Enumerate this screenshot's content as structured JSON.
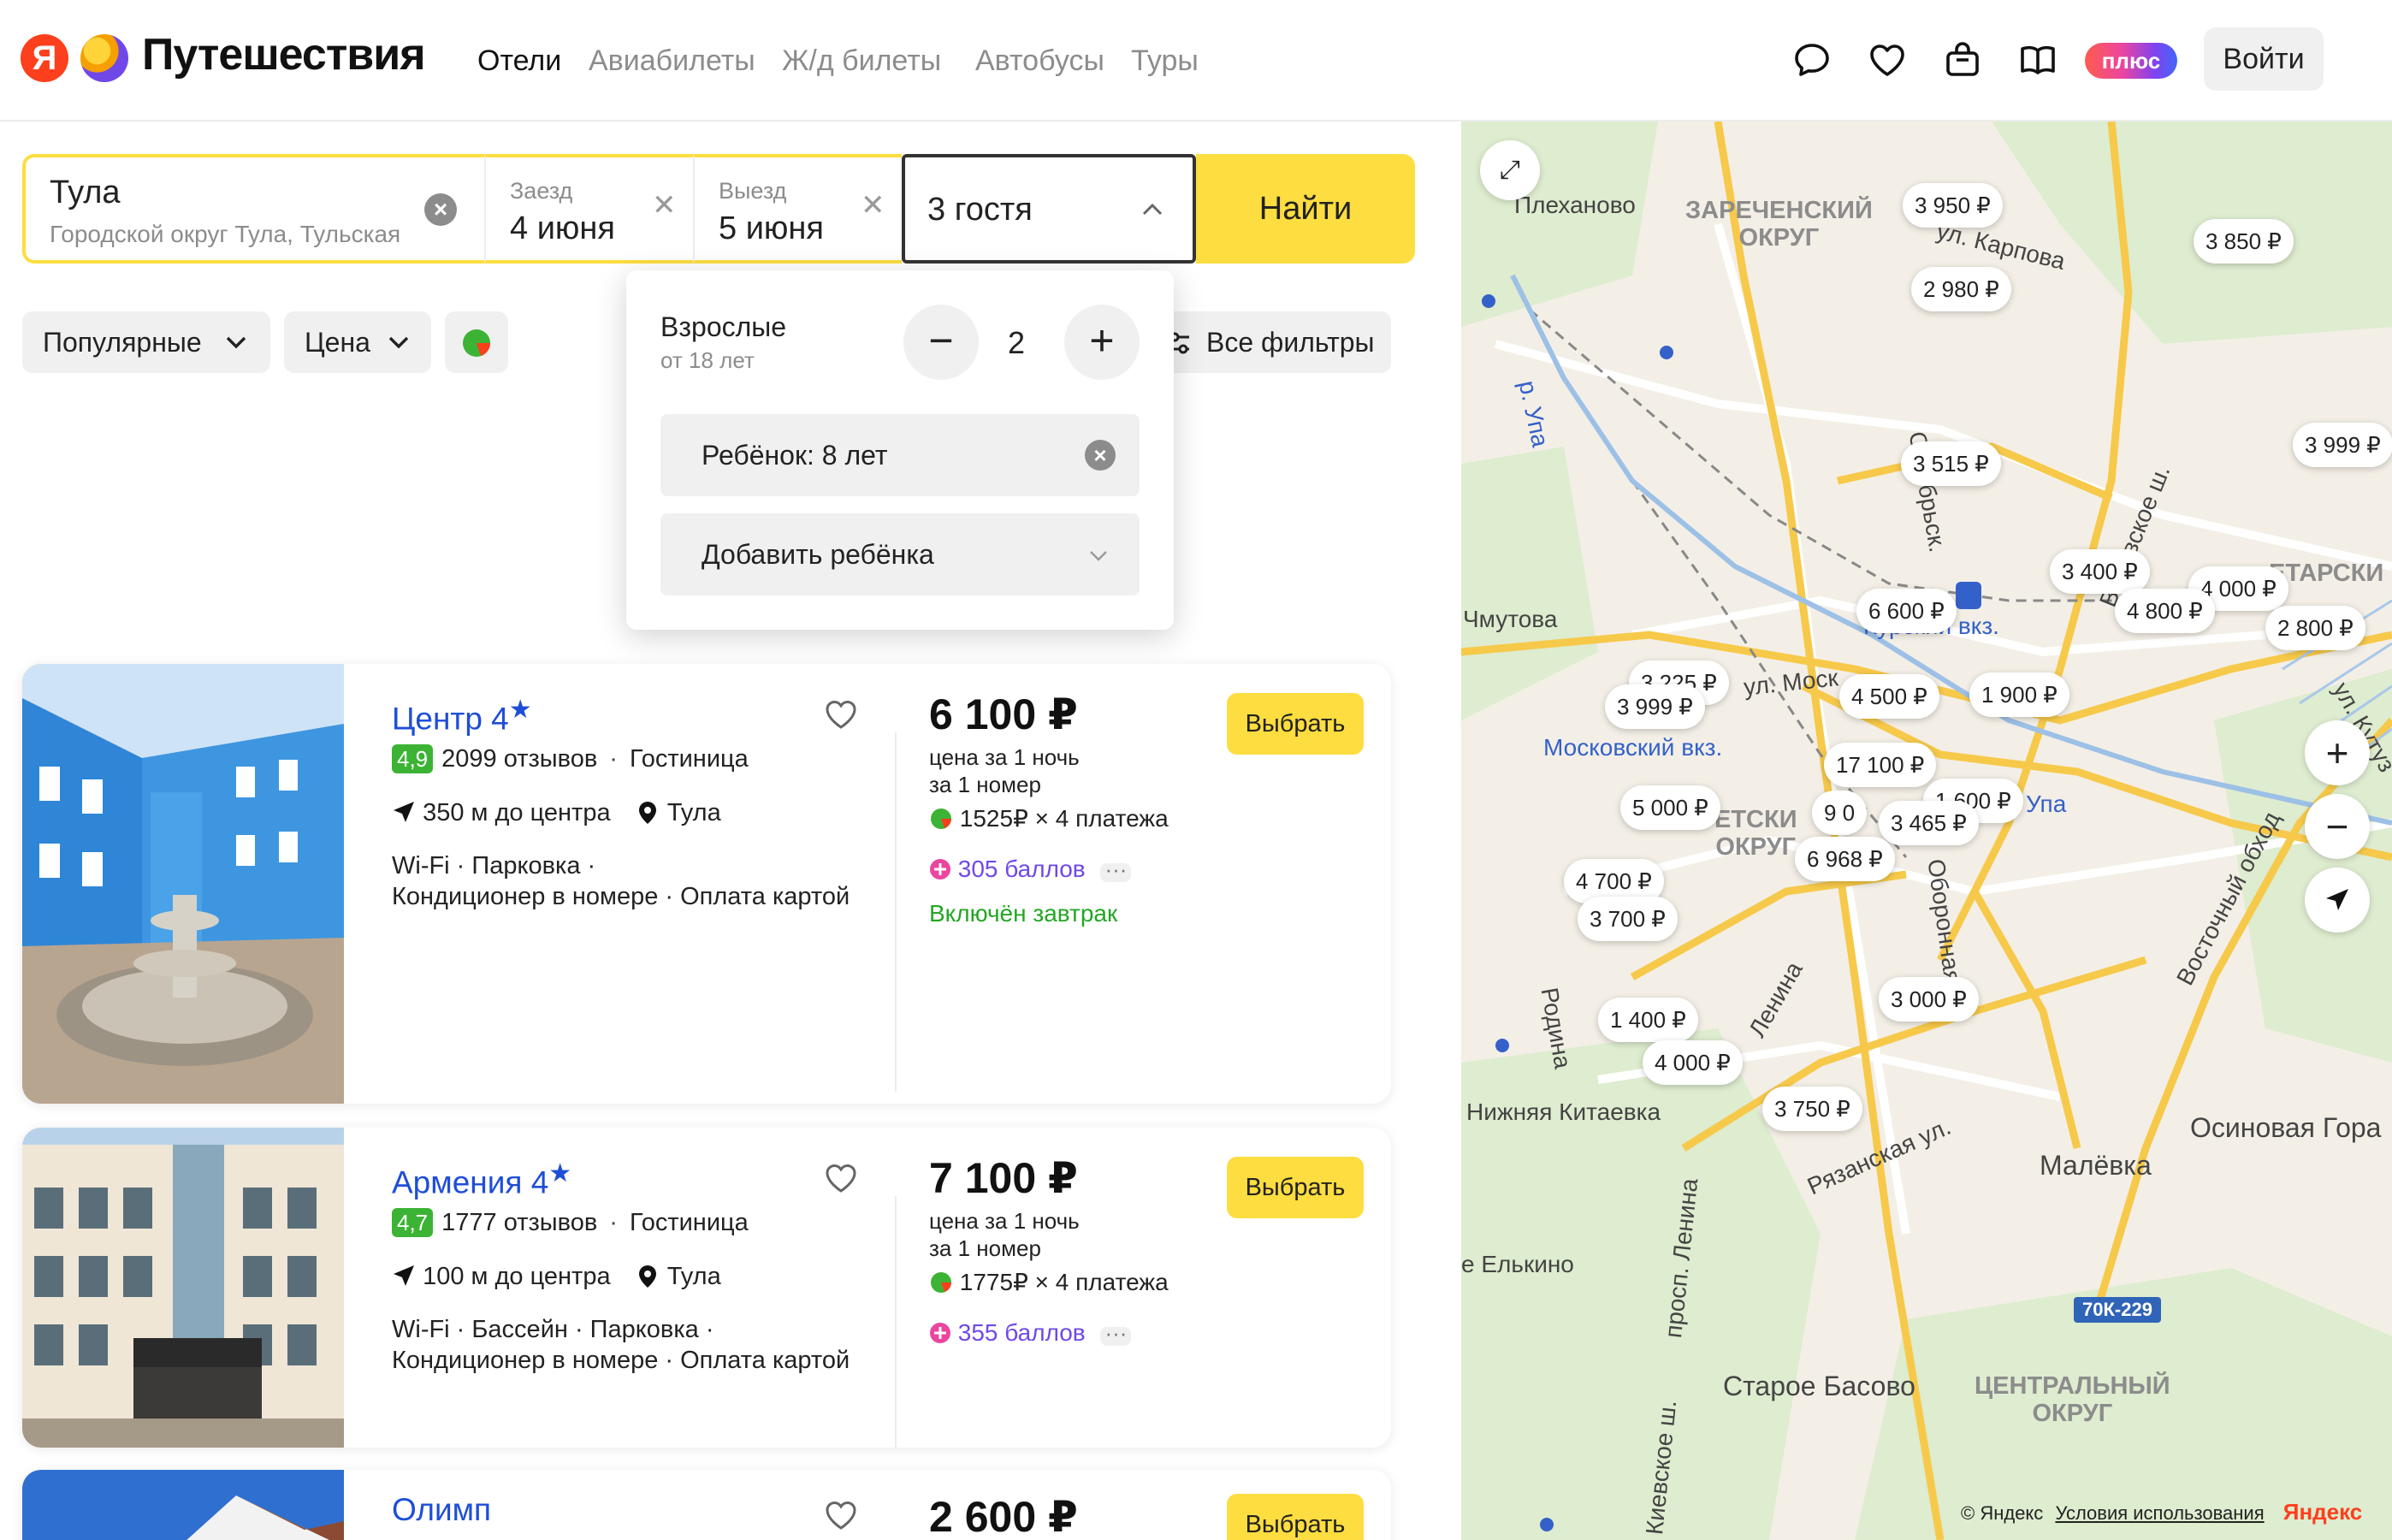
{
  "header": {
    "logo_letter": "Я",
    "brand": "Путешествия",
    "nav": [
      "Отели",
      "Авиабилеты",
      "Ж/д билеты",
      "Автобусы",
      "Туры"
    ],
    "plus_label": "плюс",
    "login_label": "Войти"
  },
  "search": {
    "city": "Тула",
    "city_sub": "Городской округ Тула, Тульская",
    "checkin_label": "Заезд",
    "checkin_value": "4 июня",
    "checkout_label": "Выезд",
    "checkout_value": "5 июня",
    "guests_value": "3 гостя",
    "find_label": "Найти"
  },
  "filters": {
    "sort_label": "Популярные",
    "price_label": "Цена",
    "all_label": "Все фильтры"
  },
  "guests_popup": {
    "adults_label": "Взрослые",
    "adults_sub": "от 18 лет",
    "adults_count": "2",
    "child_label": "Ребёнок: 8 лет",
    "add_child_label": "Добавить ребёнка"
  },
  "hotels": [
    {
      "name": "Центр 4",
      "score": "4,9",
      "reviews": "2099 отзывов",
      "type": "Гостиница",
      "distance": "350 м до центра",
      "city": "Тула",
      "amenities_line1": "Wi-Fi  · Парковка  ·",
      "amenities_line2": "Кондиционер в номере  · Оплата картой",
      "price": "6 100 ₽",
      "price_note1": "цена за 1 ночь",
      "price_note2": "за 1 номер",
      "installment": "1525₽ × 4 платежа",
      "bonus": "305 баллов",
      "breakfast": "Включён завтрак",
      "select_label": "Выбрать"
    },
    {
      "name": "Армения 4",
      "score": "4,7",
      "reviews": "1777 отзывов",
      "type": "Гостиница",
      "distance": "100 м до центра",
      "city": "Тула",
      "amenities_line1": "Wi-Fi  · Бассейн  · Парковка  ·",
      "amenities_line2": "Кондиционер в номере  · Оплата картой",
      "price": "7 100 ₽",
      "price_note1": "цена за 1 ночь",
      "price_note2": "за 1 номер",
      "installment": "1775₽ × 4 платежа",
      "bonus": "355 баллов",
      "select_label": "Выбрать"
    },
    {
      "name": "Олимп",
      "price": "2 600 ₽",
      "select_label": "Выбрать"
    }
  ],
  "map": {
    "pins": [
      "3 950 ₽",
      "3 850 ₽",
      "2 980 ₽",
      "3 999 ₽",
      "3 515 ₽",
      "3 400 ₽",
      "4 000 ₽",
      "6 600 ₽",
      "4 800 ₽",
      "2 800 ₽",
      "3 225 ₽",
      "4 500 ₽",
      "1 900 ₽",
      "3 999 ₽",
      "17 100 ₽",
      "5 000 ₽",
      "9 0",
      "1 600 ₽",
      "3 465 ₽",
      "6 968 ₽",
      "4 700 ₽",
      "3 700 ₽",
      "3 000 ₽",
      "1 400 ₽",
      "4 000 ₽",
      "3 750 ₽"
    ],
    "labels": {
      "plekhanovo": "Плеханово",
      "zarechensky": "ЗАРЕЧЕНСКИЙ",
      "okrug": "ОКРУГ",
      "karpova": "ул. Карпова",
      "oktyabrskaya": "Октябрьск.",
      "venevskoe": "Веневское ш.",
      "upa1": "р. Упа",
      "zamutova": "Чмутова",
      "moskovsky_vkz": "Московский вкз.",
      "kursky_vkz": "Курский вкз.",
      "ul_mosk": "ул. Моск",
      "proletarsky": "ЕТАРСКИ",
      "ul_kutuz": "ул. Кутуз",
      "sovetsky": "ЕТСКИ",
      "sovetsky_okrug": "ОКРУГ",
      "upa2": "Упа",
      "vostochny_obkhod": "Восточный обход",
      "oronnaya": "Оборонная ул.",
      "lenina": "Ленина",
      "rodina": "Родина",
      "nizhnyaya_kitaevka": "Нижняя Китаевка",
      "ryazanskaya": "Рязанская ул.",
      "malevka": "Малёвка",
      "osinovaya_gora": "Осиновая Гора",
      "yelkino": "е Елькино",
      "prosp_lenina": "просп. Ленина",
      "road_70k": "70К-229",
      "staroe_basovo": "Старое Басово",
      "tsentralny": "ЦЕНТРАЛЬНЫЙ",
      "tsentralny_okrug": "ОКРУГ",
      "kievskoe": "Киевское ш."
    },
    "copyright": "© Яндекс",
    "terms": "Условия использования",
    "yandex": "Яндекс",
    "zoom_in": "+",
    "zoom_out": "−"
  }
}
